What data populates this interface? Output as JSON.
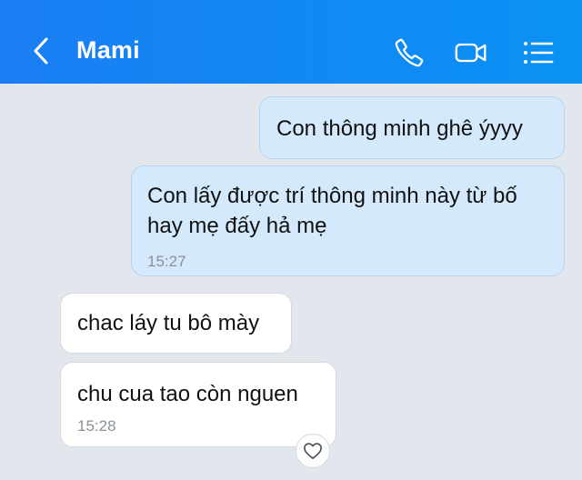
{
  "header": {
    "contact_name": "Mami",
    "icons": [
      "back-arrow-icon",
      "phone-icon",
      "video-camera-icon",
      "list-menu-icon"
    ]
  },
  "messages": [
    {
      "direction": "sent",
      "text": "Con thông minh ghê ýyyy"
    },
    {
      "direction": "sent",
      "text_line1": "Con lấy được trí thông minh này từ bố",
      "text_line2": "hay mẹ đấy hả mẹ",
      "time": "15:27"
    },
    {
      "direction": "received",
      "text": "chac láy tu bô mày"
    },
    {
      "direction": "received",
      "text": "chu cua tao còn nguen",
      "time": "15:28"
    }
  ],
  "colors": {
    "header": "#0a8af4",
    "background": "#e2e7ee",
    "sent_bubble": "#d4eafc",
    "received_bubble": "#ffffff"
  }
}
